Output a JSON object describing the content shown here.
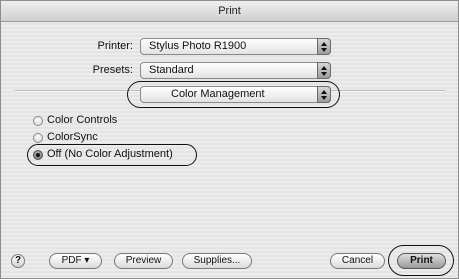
{
  "window": {
    "title": "Print"
  },
  "printer": {
    "label": "Printer:",
    "value": "Stylus Photo R1900"
  },
  "presets": {
    "label": "Presets:",
    "value": "Standard"
  },
  "panel_menu": {
    "value": "Color Management"
  },
  "color_options": [
    {
      "label": "Color Controls",
      "checked": false
    },
    {
      "label": "ColorSync",
      "checked": false
    },
    {
      "label": "Off (No Color Adjustment)",
      "checked": true
    }
  ],
  "footer": {
    "help_label": "?",
    "pdf_label": "PDF ▾",
    "preview_label": "Preview",
    "supplies_label": "Supplies...",
    "cancel_label": "Cancel",
    "print_label": "Print"
  }
}
